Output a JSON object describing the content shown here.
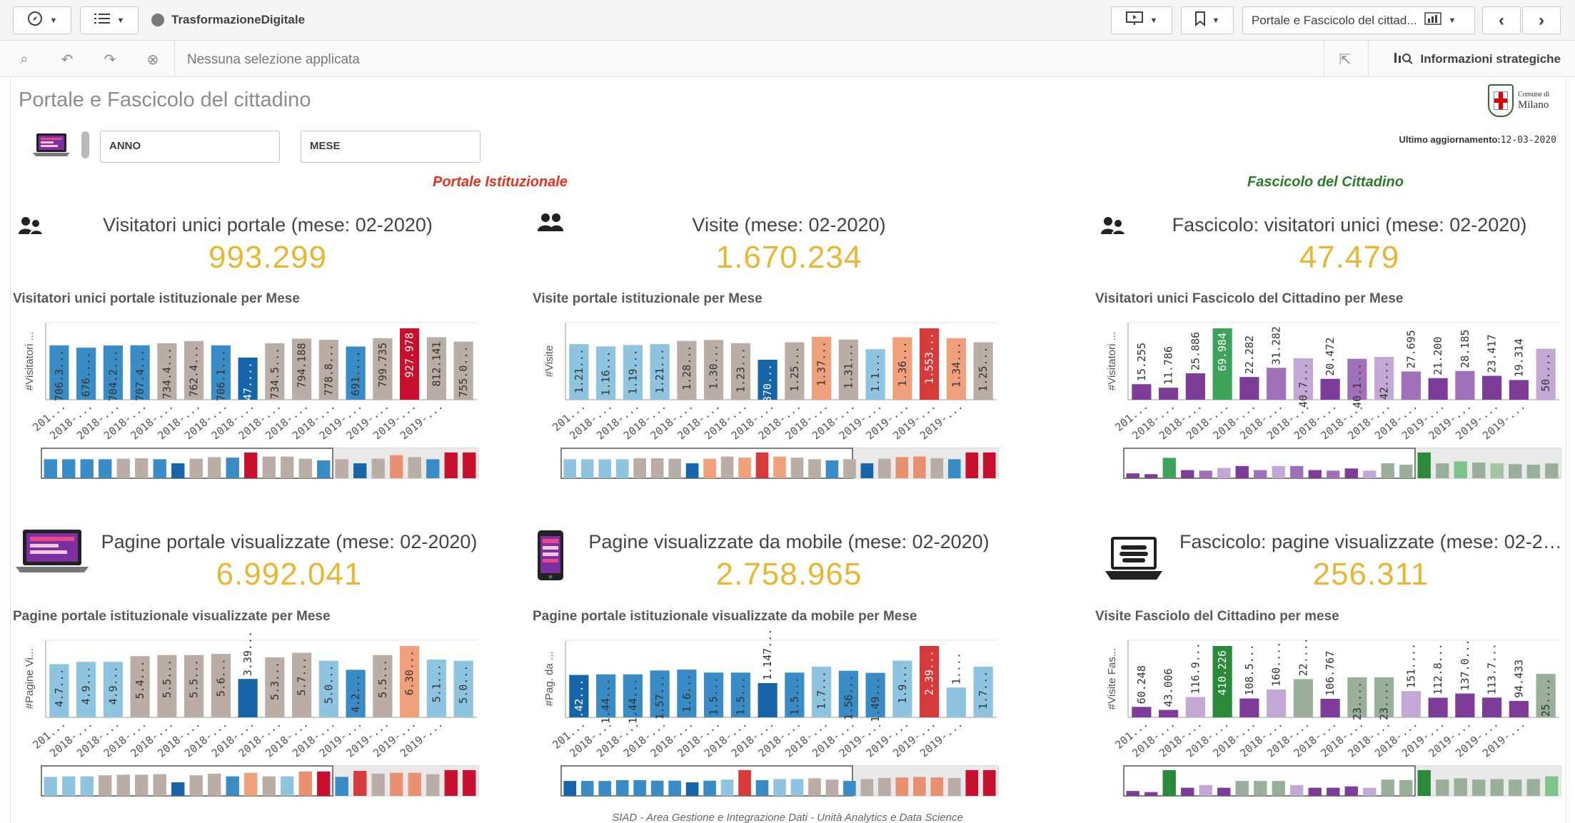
{
  "toolbar": {
    "app_title": "TrasformazioneDigitale",
    "sheet_name": "Portale e Fascicolo del cittad..."
  },
  "selections": {
    "text": "Nessuna selezione applicata",
    "insights_label": "Informazioni strategiche"
  },
  "sheet": {
    "title": "Portale e Fascicolo del cittadino",
    "logo_text_line1": "Comune di",
    "logo_text_line2": "Milano",
    "update_label": "Ultimo aggiornamento:",
    "update_date": "12-03-2020"
  },
  "filters": {
    "year": "ANNO",
    "month": "MESE"
  },
  "sections": {
    "portal": "Portale Istituzionale",
    "fascicolo": "Fascicolo del Cittadino"
  },
  "colors": {
    "section_portal": "#e8301e",
    "section_fascicolo": "#2a7a2a",
    "kpi_value": "#e8b731"
  },
  "kpis": [
    {
      "icon": "user-group-icon",
      "label": "Visitatori unici portale (mese: 02-2020)",
      "value": "993.299"
    },
    {
      "icon": "users-icon",
      "label": "Visite (mese: 02-2020)",
      "value": "1.670.234"
    },
    {
      "icon": "user-group-icon",
      "label": "Fascicolo: visitatori unici (mese: 02-2020)",
      "value": "47.479"
    },
    {
      "icon": "laptop-icon",
      "label": "Pagine portale visualizzate (mese: 02-2020)",
      "value": "6.992.041"
    },
    {
      "icon": "mobile-icon",
      "label": "Pagine visualizzate da mobile (mese: 02-2020)",
      "value": "2.758.965"
    },
    {
      "icon": "laptop-books-icon",
      "label": "Fascicolo: pagine visualizzate (mese: 02-20...",
      "value": "256.311"
    }
  ],
  "chart_data": [
    {
      "type": "bar",
      "title": "Visitatori unici portale istituzionale per Mese",
      "ylabel": "#Visitatori ...",
      "categories": [
        "201...",
        "2018-...",
        "2018-...",
        "2018-...",
        "2018-...",
        "2018-...",
        "2018-...",
        "2018-...",
        "2018-...",
        "2018-...",
        "2018-...",
        "2019-...",
        "2019-...",
        "2019-...",
        "2019-..."
      ],
      "values": [
        706,
        676,
        704,
        707,
        734,
        762,
        706,
        547,
        734,
        794,
        778,
        691,
        799,
        927,
        812,
        755
      ],
      "labels": [
        "706.3...",
        "676....",
        "704.2...",
        "707.4...",
        "734.4...",
        "762.4...",
        "706.1...",
        "547....",
        "734.5...",
        "794.188",
        "778.8...",
        "691....",
        "799.735",
        "927.978",
        "812.141",
        "755.0..."
      ],
      "colors": [
        "#3a8cc6",
        "#3a8cc6",
        "#3a8cc6",
        "#3a8cc6",
        "#b9ada6",
        "#b9ada6",
        "#3a8cc6",
        "#1565a8",
        "#b9ada6",
        "#b9ada6",
        "#b9ada6",
        "#3a8cc6",
        "#b9ada6",
        "#c8102e",
        "#b9ada6",
        "#b9ada6"
      ],
      "mini": [
        "#3a8cc6",
        "#3a8cc6",
        "#3a8cc6",
        "#3a8cc6",
        "#b9ada6",
        "#b9ada6",
        "#3a8cc6",
        "#1565a8",
        "#b9ada6",
        "#b9ada6",
        "#3a8cc6",
        "#c8102e",
        "#b9ada6",
        "#b9ada6",
        "#b9ada6",
        "#3a8cc6",
        "#b9ada6",
        "#1565a8",
        "#b9ada6",
        "#e89070",
        "#b9ada6",
        "#3a8cc6",
        "#c8102e",
        "#c8102e"
      ],
      "mini_heights": [
        0.7,
        0.7,
        0.7,
        0.7,
        0.72,
        0.74,
        0.7,
        0.55,
        0.72,
        0.78,
        0.76,
        0.95,
        0.8,
        0.8,
        0.72,
        0.66,
        0.7,
        0.55,
        0.72,
        0.85,
        0.78,
        0.7,
        0.95,
        0.95
      ]
    },
    {
      "type": "bar",
      "title": "Visite portale istituzionale per Mese",
      "ylabel": "#Visite",
      "categories": [
        "201...",
        "2018-...",
        "2018-...",
        "2018-...",
        "2018-...",
        "2018-...",
        "2018-...",
        "2018-...",
        "2018-...",
        "2018-...",
        "2018-...",
        "2019-...",
        "2019-...",
        "2019-...",
        "2019-..."
      ],
      "values": [
        1210,
        1160,
        1190,
        1210,
        1280,
        1300,
        1230,
        870,
        1250,
        1370,
        1310,
        1100,
        1360,
        1553,
        1340,
        1250
      ],
      "labels": [
        "1.21...",
        "1.16...",
        "1.19...",
        "1.21...",
        "1.28...",
        "1.30...",
        "1.23...",
        "870...",
        "1.25...",
        "1.37...",
        "1.31...",
        "1.1...",
        "1.36...",
        "1.553...",
        "1.34...",
        "1.25..."
      ],
      "colors": [
        "#8ec4e0",
        "#8ec4e0",
        "#8ec4e0",
        "#8ec4e0",
        "#b9ada6",
        "#b9ada6",
        "#b9ada6",
        "#1565a8",
        "#b9ada6",
        "#f0a07a",
        "#b9ada6",
        "#8ec4e0",
        "#f0a07a",
        "#d63a3a",
        "#f0a07a",
        "#b9ada6"
      ],
      "mini": [
        "#8ec4e0",
        "#8ec4e0",
        "#8ec4e0",
        "#8ec4e0",
        "#b9ada6",
        "#b9ada6",
        "#b9ada6",
        "#1565a8",
        "#f0a07a",
        "#b9ada6",
        "#f0a07a",
        "#d63a3a",
        "#f0a07a",
        "#b9ada6",
        "#b9ada6",
        "#3a8cc6",
        "#b9ada6",
        "#1565a8",
        "#b9ada6",
        "#e89070",
        "#e89070",
        "#b9ada6",
        "#3a8cc6",
        "#c8102e",
        "#c8102e"
      ],
      "mini_heights": [
        0.7,
        0.7,
        0.7,
        0.7,
        0.74,
        0.74,
        0.72,
        0.55,
        0.72,
        0.8,
        0.76,
        0.95,
        0.8,
        0.76,
        0.7,
        0.66,
        0.7,
        0.55,
        0.72,
        0.78,
        0.8,
        0.74,
        0.7,
        0.95,
        0.95
      ]
    },
    {
      "type": "bar",
      "title": "Visitatori unici Fascicolo del Cittadino per Mese",
      "ylabel": "#Visitatori ...",
      "categories": [
        "201...",
        "2018-...",
        "2018-...",
        "2018-...",
        "2018-...",
        "2018-...",
        "2018-...",
        "2018-...",
        "2018-...",
        "2018-...",
        "2018-...",
        "2019-...",
        "2019-...",
        "2019-...",
        "2019-..."
      ],
      "values": [
        15255,
        11786,
        25886,
        69984,
        22282,
        31282,
        40700,
        20472,
        40100,
        42000,
        27695,
        21200,
        28185,
        23417,
        19314,
        50000
      ],
      "labels": [
        "15.255",
        "11.786",
        "25.886",
        "69.984",
        "22.282",
        "31.282",
        "40.7...",
        "20.472",
        "40.1...",
        "42....",
        "27.695",
        "21.200",
        "28.185",
        "23.417",
        "19.314",
        "50...."
      ],
      "colors": [
        "#7d3c98",
        "#7d3c98",
        "#7d3c98",
        "#3ea35a",
        "#7d3c98",
        "#a070b8",
        "#c3a8d6",
        "#7d3c98",
        "#a070b8",
        "#c3a8d6",
        "#a070b8",
        "#7d3c98",
        "#a070b8",
        "#7d3c98",
        "#7d3c98",
        "#c3a8d6"
      ],
      "mini": [
        "#7d3c98",
        "#7d3c98",
        "#3ea35a",
        "#7d3c98",
        "#a070b8",
        "#c3a8d6",
        "#7d3c98",
        "#a070b8",
        "#c3a8d6",
        "#a070b8",
        "#7d3c98",
        "#a070b8",
        "#7d3c98",
        "#c3a8d6",
        "#9aaf9a",
        "#9aaf9a",
        "#2a8a3a",
        "#9aaf9a",
        "#7cc48a",
        "#9aaf9a",
        "#a5c4a5",
        "#9aaf9a",
        "#9aaf9a",
        "#9aaf9a"
      ],
      "mini_heights": [
        0.18,
        0.15,
        0.75,
        0.3,
        0.28,
        0.38,
        0.45,
        0.3,
        0.45,
        0.45,
        0.3,
        0.28,
        0.36,
        0.28,
        0.55,
        0.5,
        0.95,
        0.55,
        0.62,
        0.58,
        0.55,
        0.52,
        0.5,
        0.55
      ]
    },
    {
      "type": "bar",
      "title": "Pagine portale istituzionale visualizzate per Mese",
      "ylabel": "#Pagine Vi...",
      "categories": [
        "201...",
        "2018-...",
        "2018-...",
        "2018-...",
        "2018-...",
        "2018-...",
        "2018-...",
        "2018-...",
        "2018-...",
        "2018-...",
        "2018-...",
        "2019-...",
        "2019-...",
        "2019-...",
        "2019-..."
      ],
      "values": [
        4.7,
        4.9,
        4.9,
        5.4,
        5.5,
        5.5,
        5.6,
        3.39,
        5.3,
        5.7,
        5.0,
        4.2,
        5.5,
        6.3,
        5.1,
        5.0
      ],
      "labels": [
        "4.7...",
        "4.9...",
        "4.9...",
        "5.4...",
        "5.5...",
        "5.5...",
        "5.6...",
        "3.39...",
        "5.3...",
        "5.7...",
        "5.0...",
        "4.2...",
        "5.5...",
        "6.30...",
        "5.1...",
        "5.0..."
      ],
      "colors": [
        "#8ec4e0",
        "#8ec4e0",
        "#8ec4e0",
        "#b9ada6",
        "#b9ada6",
        "#b9ada6",
        "#b9ada6",
        "#1565a8",
        "#b9ada6",
        "#b9ada6",
        "#8ec4e0",
        "#3a8cc6",
        "#b9ada6",
        "#f0a07a",
        "#8ec4e0",
        "#8ec4e0"
      ],
      "mini": [
        "#8ec4e0",
        "#8ec4e0",
        "#8ec4e0",
        "#b9ada6",
        "#b9ada6",
        "#b9ada6",
        "#b9ada6",
        "#1565a8",
        "#b9ada6",
        "#b9ada6",
        "#3a8cc6",
        "#f0a07a",
        "#b9ada6",
        "#8ec4e0",
        "#e89070",
        "#c8102e",
        "#3a8cc6",
        "#d63a3a",
        "#b9ada6",
        "#e89070",
        "#e89070",
        "#b9ada6",
        "#c8102e",
        "#c8102e"
      ],
      "mini_heights": [
        0.7,
        0.72,
        0.72,
        0.76,
        0.78,
        0.78,
        0.8,
        0.5,
        0.76,
        0.82,
        0.72,
        0.85,
        0.72,
        0.72,
        0.9,
        0.9,
        0.7,
        0.92,
        0.82,
        0.85,
        0.85,
        0.8,
        0.95,
        0.95
      ]
    },
    {
      "type": "bar",
      "title": "Pagine portale istituzionale visualizzate da mobile per Mese",
      "ylabel": "#Pag. da ...",
      "categories": [
        "201...",
        "2018-...",
        "2018-...",
        "2018-...",
        "2018-...",
        "2018-...",
        "2018-...",
        "2018-...",
        "2018-...",
        "2018-...",
        "2018-...",
        "2019-...",
        "2019-...",
        "2019-...",
        "2019-..."
      ],
      "values": [
        1.42,
        1.44,
        1.44,
        1.57,
        1.6,
        1.5,
        1.5,
        1.147,
        1.5,
        1.7,
        1.56,
        1.49,
        1.9,
        2.39,
        1.0,
        1.7
      ],
      "labels": [
        "1.42...",
        "1.44...",
        "1.44...",
        "1.57...",
        "1.6...",
        "1.5...",
        "1.5...",
        "1.147...",
        "1.5...",
        "1.7...",
        "1.56...",
        "1.49...",
        "1.9...",
        "2.39...",
        "1....",
        "1.7..."
      ],
      "colors": [
        "#1565a8",
        "#3a8cc6",
        "#3a8cc6",
        "#3a8cc6",
        "#3a8cc6",
        "#3a8cc6",
        "#3a8cc6",
        "#1565a8",
        "#3a8cc6",
        "#8ec4e0",
        "#3a8cc6",
        "#3a8cc6",
        "#8ec4e0",
        "#d63a3a",
        "#8ec4e0",
        "#8ec4e0"
      ],
      "mini": [
        "#1565a8",
        "#3a8cc6",
        "#3a8cc6",
        "#3a8cc6",
        "#3a8cc6",
        "#3a8cc6",
        "#3a8cc6",
        "#1565a8",
        "#3a8cc6",
        "#8ec4e0",
        "#d63a3a",
        "#3a8cc6",
        "#8ec4e0",
        "#8ec4e0",
        "#b9ada6",
        "#b9ada6",
        "#3a8cc6",
        "#b9ada6",
        "#b9ada6",
        "#e89070",
        "#e89070",
        "#e89070",
        "#b9ada6",
        "#c8102e",
        "#c8102e"
      ],
      "mini_heights": [
        0.55,
        0.55,
        0.55,
        0.58,
        0.58,
        0.56,
        0.56,
        0.5,
        0.56,
        0.6,
        0.95,
        0.58,
        0.62,
        0.62,
        0.65,
        0.6,
        0.55,
        0.62,
        0.66,
        0.68,
        0.7,
        0.68,
        0.66,
        0.95,
        0.95
      ]
    },
    {
      "type": "bar",
      "title": "Visite Fasciolo del Cittadino per mese",
      "ylabel": "#Visite Fas...",
      "categories": [
        "201...",
        "2018-...",
        "2018-...",
        "2018-...",
        "2018-...",
        "2018-...",
        "2018-...",
        "2018-...",
        "2018-...",
        "2018-...",
        "2018-...",
        "2019-...",
        "2019-...",
        "2019-...",
        "2019-..."
      ],
      "values": [
        60248,
        43006,
        116900,
        410226,
        108500,
        160000,
        220000,
        106767,
        230000,
        230000,
        151000,
        112800,
        137000,
        113700,
        94433,
        250000
      ],
      "labels": [
        "60.248",
        "43.006",
        "116.9...",
        "410.226",
        "108.5...",
        "160....",
        "22....",
        "106.767",
        "23....",
        "23....",
        "151....",
        "112.8...",
        "137.0...",
        "113.7...",
        "94.433",
        "25...."
      ],
      "colors": [
        "#7d3c98",
        "#7d3c98",
        "#c3a8d6",
        "#2a8a3a",
        "#7d3c98",
        "#c3a8d6",
        "#9aaf9a",
        "#7d3c98",
        "#9aaf9a",
        "#9aaf9a",
        "#c3a8d6",
        "#7d3c98",
        "#7d3c98",
        "#7d3c98",
        "#7d3c98",
        "#9aaf9a"
      ],
      "mini": [
        "#7d3c98",
        "#7d3c98",
        "#2a8a3a",
        "#7d3c98",
        "#c3a8d6",
        "#7d3c98",
        "#9aaf9a",
        "#9aaf9a",
        "#9aaf9a",
        "#c3a8d6",
        "#7d3c98",
        "#7d3c98",
        "#7d3c98",
        "#c3a8d6",
        "#9aaf9a",
        "#9aaf9a",
        "#2a8a3a",
        "#9aaf9a",
        "#9aaf9a",
        "#9aaf9a",
        "#9aaf9a",
        "#9aaf9a",
        "#9aaf9a",
        "#7cc48a"
      ],
      "mini_heights": [
        0.18,
        0.14,
        0.95,
        0.3,
        0.4,
        0.3,
        0.55,
        0.55,
        0.55,
        0.4,
        0.3,
        0.3,
        0.35,
        0.3,
        0.6,
        0.58,
        0.95,
        0.6,
        0.65,
        0.6,
        0.62,
        0.6,
        0.62,
        0.72
      ]
    }
  ],
  "footer": "SIAD - Area Gestione e Integrazione Dati - Unità Analytics e Data Science"
}
